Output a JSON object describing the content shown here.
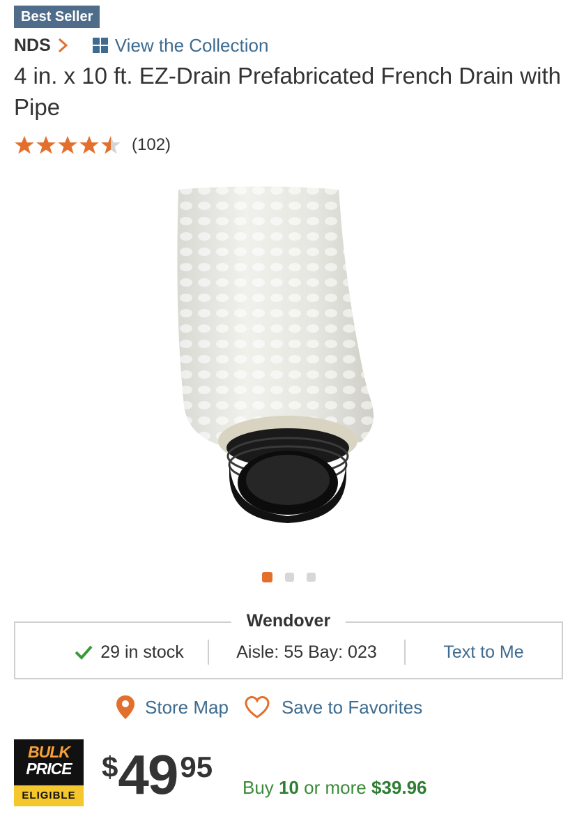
{
  "badge": {
    "label": "Best Seller"
  },
  "brand": {
    "name": "NDS",
    "collection_label": "View the Collection"
  },
  "product": {
    "title": "4 in. x 10 ft. EZ-Drain Prefabricated French Drain with Pipe"
  },
  "rating": {
    "stars": 4.5,
    "max": 5,
    "count_label": "(102)"
  },
  "gallery": {
    "count": 3,
    "active_index": 0
  },
  "store": {
    "name": "Wendover",
    "stock_label": "29 in stock",
    "location_label": "Aisle: 55 Bay: 023",
    "text_to_me_label": "Text to Me"
  },
  "actions": {
    "store_map_label": "Store Map",
    "favorites_label": "Save to Favorites"
  },
  "bulk_logo": {
    "line1": "BULK",
    "line2": "PRICE",
    "line3": "ELIGIBLE"
  },
  "price": {
    "dollar_sign": "$",
    "whole": "49",
    "cents": "95"
  },
  "bulk_offer": {
    "prefix": "Buy ",
    "quantity": "10",
    "middle": " or more ",
    "price": "$39.96"
  },
  "colors": {
    "accent_orange": "#e36f2c",
    "link_blue": "#3e6b8f",
    "badge_bg": "#4f6d8a",
    "stock_green": "#3a9a3a"
  }
}
